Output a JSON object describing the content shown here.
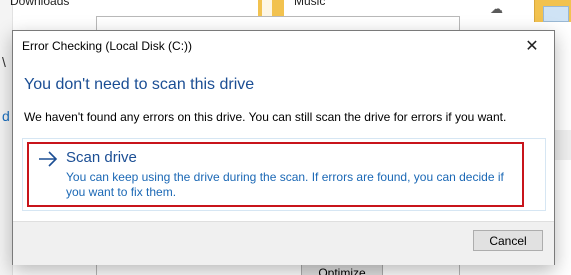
{
  "background": {
    "downloads_label": "Downloads",
    "music_label": "Music",
    "optimize_label": "Optimize",
    "cloud_icon": "cloud-icon",
    "folder_icon": "folder-icon"
  },
  "dialog": {
    "title": "Error Checking (Local Disk (C:))",
    "close_glyph": "✕",
    "heading": "You don't need to scan this drive",
    "message": "We haven't found any errors on this drive. You can still scan the drive for errors if you want.",
    "scan_option": {
      "icon": "arrow-right-icon",
      "title": "Scan drive",
      "description": "You can keep using the drive during the scan. If errors are found, you can decide if you want to fix them."
    },
    "cancel_label": "Cancel"
  },
  "colors": {
    "heading_blue": "#1b4e94",
    "link_blue": "#1b68b5",
    "highlight_red": "#c8141b"
  }
}
